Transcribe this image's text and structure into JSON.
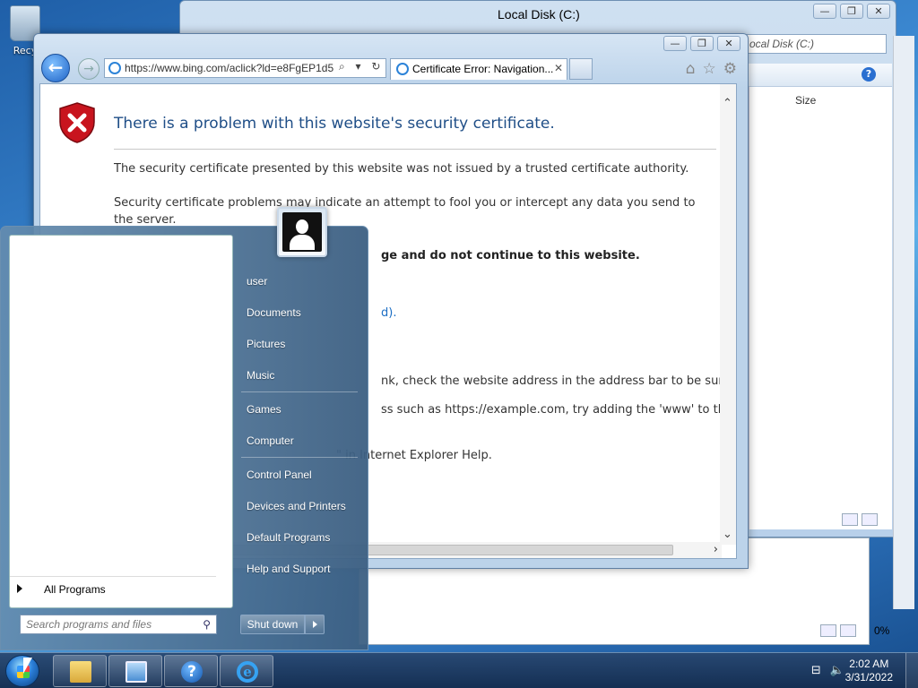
{
  "desktop": {
    "recycle_bin_label": "Recy"
  },
  "explorer": {
    "title": "Local Disk (C:)",
    "address_placeholder": "ocal Disk (C:)",
    "column_size": "Size",
    "window_controls": {
      "minimize": "—",
      "restore": "❐",
      "close": "✕"
    },
    "zoom_status": "0%"
  },
  "ie": {
    "url": "https://www.bing.com/aclick?ld=e8FgEP1d5",
    "tab_title": "Certificate Error: Navigation...",
    "window_controls": {
      "minimize": "—",
      "restore": "❐",
      "close": "✕"
    },
    "headline": "There is a problem with this website's security certificate.",
    "para1": "The security certificate presented by this website was not issued by a trusted certificate authority.",
    "para2": "Security certificate problems may indicate an attempt to fool you or intercept any data you send to the server.",
    "para3": "ge and do not continue to this website.",
    "para4": "d).",
    "para5": "nk, check the website address in the address bar to be sure",
    "para6": "ss such as https://example.com, try adding the 'www' to the",
    "para7": "\" in Internet Explorer Help."
  },
  "start_menu": {
    "user": "user",
    "items": [
      "Documents",
      "Pictures",
      "Music",
      "Games",
      "Computer",
      "Control Panel",
      "Devices and Printers",
      "Default Programs",
      "Help and Support"
    ],
    "all_programs": "All Programs",
    "search_placeholder": "Search programs and files",
    "shutdown": "Shut down"
  },
  "taskbar": {
    "time": "2:02 AM",
    "date": "3/31/2022"
  },
  "icons": {
    "shield": "security-shield-icon",
    "back": "back-arrow-icon",
    "forward": "forward-arrow-icon",
    "home": "home-icon",
    "favorites": "star-icon",
    "tools": "gear-icon",
    "search": "search-icon",
    "help": "help-icon"
  },
  "colors": {
    "headline": "#1f4e87",
    "link": "#1c6ec4",
    "shield_red": "#c8141e"
  }
}
